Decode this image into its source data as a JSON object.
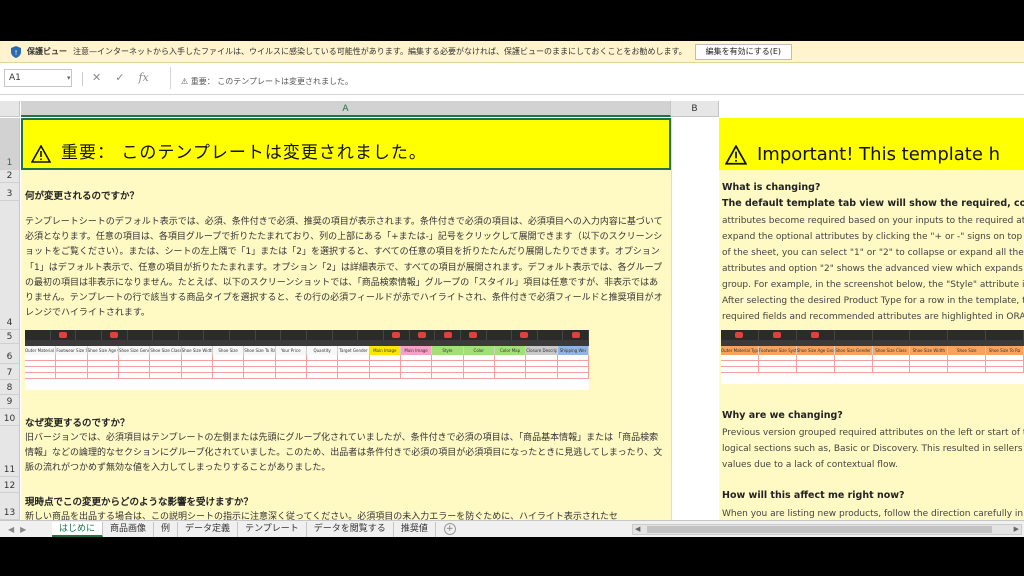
{
  "protected_view": {
    "title": "保護ビュー",
    "message": "注意—インターネットから入手したファイルは、ウイルスに感染している可能性があります。編集する必要がなければ、保護ビューのままにしておくことをお勧めします。",
    "enable_button": "編集を有効にする(E)"
  },
  "formula_bar": {
    "name_box": "A1",
    "formula": "⚠ 重要： このテンプレートは変更されました。"
  },
  "columns": [
    "A",
    "B"
  ],
  "rows": [
    "1",
    "2",
    "3",
    "4",
    "5",
    "6",
    "7",
    "8",
    "9",
    "10",
    "11",
    "12",
    "13"
  ],
  "jp": {
    "banner": "重要： このテンプレートは変更されました。",
    "h1": "何が変更されるのですか？",
    "p1": "テンプレートシートのデフォルト表示では、必須、条件付きで必須、推奨の項目が表示されます。条件付きで必須の項目は、必須項目への入力内容に基づいて必須となります。任意の項目は、各項目グループで折りたたまれており、列の上部にある「+または-」記号をクリックして展開できます（以下のスクリーンショットをご覧ください）。または、シートの左上隅で「1」または「2」を選択すると、すべての任意の項目を折りたたんだり展開したりできます。オプション「1」はデフォルト表示で、任意の項目が折りたたまれます。オプション「2」は詳細表示で、すべての項目が展開されます。デフォルト表示では、各グループの最初の項目は非表示になりません。たとえば、以下のスクリーンショットでは、「商品検索情報」グループの「スタイル」項目は任意ですが、非表示ではありません。テンプレートの行で該当する商品タイプを選択すると、その行の必須フィールドが赤でハイライトされ、条件付きで必須フィールドと推奨項目がオレンジでハイライトされます。",
    "h2": "なぜ変更するのですか？",
    "p2": "旧バージョンでは、必須項目はテンプレートの左側または先頭にグループ化されていましたが、条件付きで必須の項目は、「商品基本情報」または「商品検索情報」などの論理的なセクションにグループ化されていました。このため、出品者は条件付きで必須の項目が必須項目になったときに見逃してしまったり、文脈の流れがつかめず無効な値を入力してしまったりすることがありました。",
    "h3": "現時点でこの変更からどのような影響を受けますか？",
    "p3": "新しい商品を出品する場合は、この説明シートの指示に注意深く従ってください。必須項目の未入力エラーを防ぐために、ハイライト表示されたセ"
  },
  "en": {
    "banner": "Important! This template h",
    "h1": "What is changing?",
    "lines1": [
      "The default template tab view will show the required, conditional",
      "attributes become required based on your inputs to the required attr",
      "expand the optional attributes by clicking the \"+ or -\" signs on top of",
      "of the sheet, you can select \"1\" or \"2\" to collapse or expand all the op",
      "attributes and option \"2\" shows the advanced view which expands al",
      "group. For example, in the screenshot below, the \"Style\" attribute in",
      "After selecting the desired Product Type for a row in the template, t",
      "required fields and recommended attributes are highlighted in ORAN"
    ],
    "h2": "Why are we changing?",
    "lines2": [
      "Previous version grouped required attributes on the left or start of th",
      "logical sections such as, Basic or Discovery. This resulted in sellers",
      "values due to a lack of contextual flow."
    ],
    "h3": "How will this affect me right now?",
    "lines3": [
      "When you are listing new products, follow the direction carefully in t"
    ]
  },
  "sheet_tabs": [
    "はじめに",
    "商品画像",
    "例",
    "データ定義",
    "テンプレート",
    "データを閲覧する",
    "推奨値"
  ],
  "mini_table_jp": [
    "Outer Material Type",
    "Footwear Size System",
    "Shoe Size Age Group",
    "Shoe Size Gender",
    "Shoe Size Class",
    "Shoe Size Width",
    "Shoe Size",
    "Shoe Size To Range",
    "Your Price",
    "Quantity",
    "Target Gender",
    "Main Image",
    "Main Image",
    "Style",
    "Color",
    "Color Map",
    "Closure Description",
    "Shipping Wei"
  ],
  "mini_table_en": [
    "Outer Material Type",
    "Footwear Size System",
    "Shoe Size Age Group",
    "Shoe Size Gender",
    "Shoe Size Class",
    "Shoe Size Width",
    "Shoe Size",
    "Shoe Size To Ra"
  ],
  "colors": {
    "banner": "#ffff00",
    "panel": "#fff9c4",
    "accent": "#217346"
  }
}
